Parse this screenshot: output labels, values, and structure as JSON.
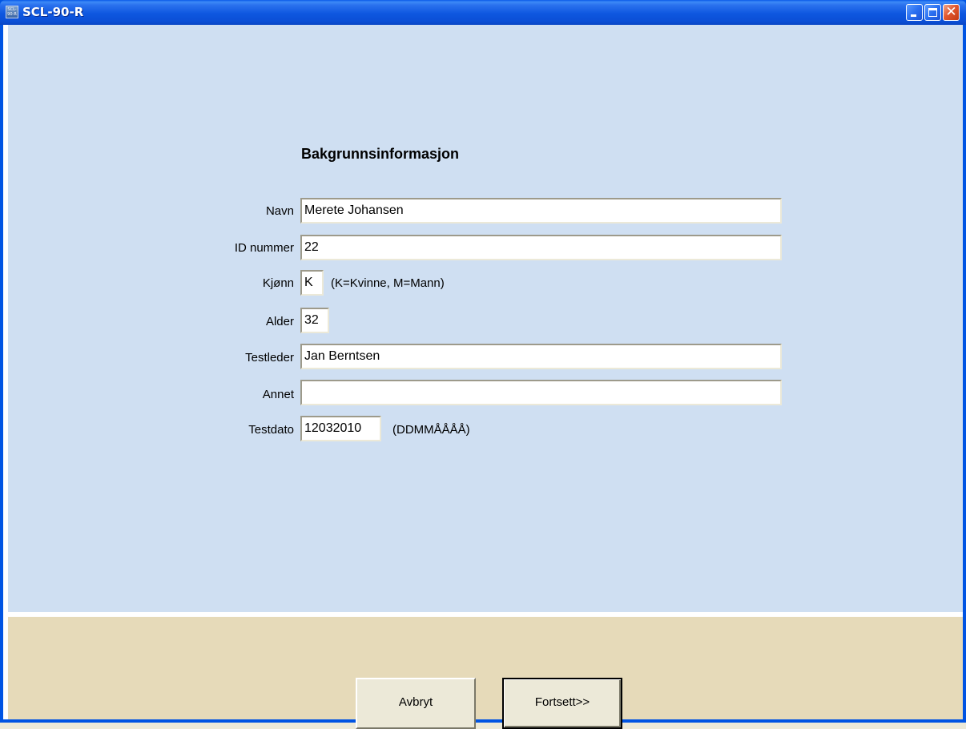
{
  "window": {
    "title": "SCL-90-R",
    "icon_text": "SCL-90-R",
    "icon": "app-icon",
    "controls": {
      "minimize": "minimize-icon",
      "maximize": "maximize-icon",
      "close": "close-icon",
      "close_glyph": "✕"
    }
  },
  "form": {
    "heading": "Bakgrunnsinformasjon",
    "fields": {
      "navn": {
        "label": "Navn",
        "value": "Merete Johansen"
      },
      "id_nummer": {
        "label": "ID nummer",
        "value": "22"
      },
      "kjonn": {
        "label": "Kjønn",
        "value": "K",
        "hint": "(K=Kvinne, M=Mann)"
      },
      "alder": {
        "label": "Alder",
        "value": "32"
      },
      "testleder": {
        "label": "Testleder",
        "value": "Jan Berntsen"
      },
      "annet": {
        "label": "Annet",
        "value": ""
      },
      "testdato": {
        "label": "Testdato",
        "value": "12032010",
        "hint": "(DDMMÅÅÅÅ)"
      }
    }
  },
  "buttons": {
    "cancel": "Avbryt",
    "continue": "Fortsett>>"
  },
  "colors": {
    "form_background": "#cfdff2",
    "bottom_background": "#e6dab9",
    "titlebar": "#0a5be8"
  }
}
